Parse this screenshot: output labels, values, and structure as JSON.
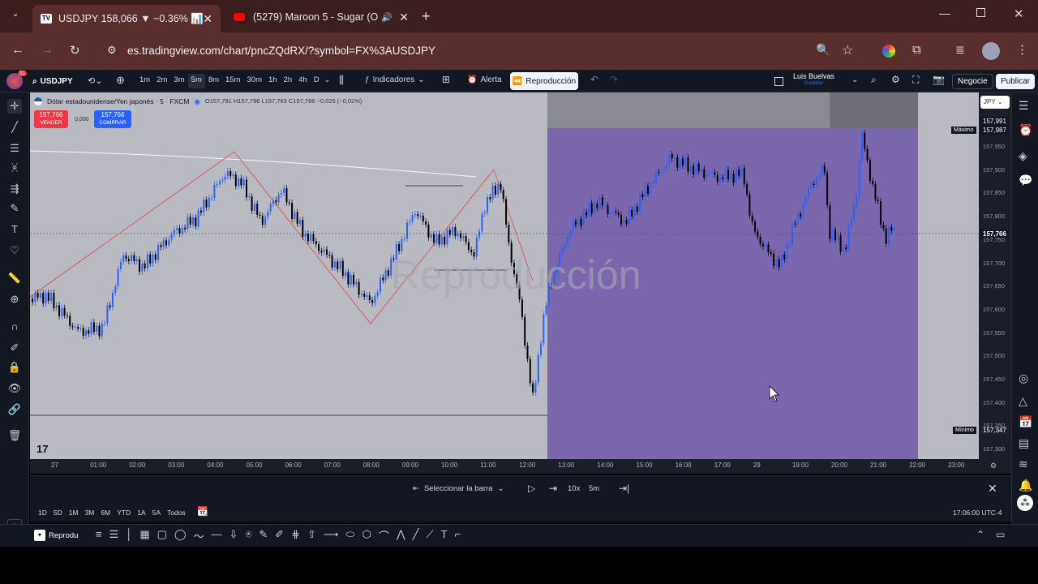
{
  "browser": {
    "tab1_title": "USDJPY 158,066 ▼ −0.36% 📊",
    "tab2_title": "(5279) Maroon 5 - Sugar (O",
    "url": "es.tradingview.com/chart/pncZQdRX/?symbol=FX%3AUSDJPY"
  },
  "toolbar": {
    "symbol": "USDJPY",
    "intervals": [
      "1m",
      "2m",
      "3m",
      "5m",
      "8m",
      "15m",
      "30m",
      "1h",
      "2h",
      "4h",
      "D"
    ],
    "active_interval": "5m",
    "indicators": "Indicadores",
    "alert": "Alerta",
    "replay": "Reproducción",
    "user": "Luis Buelvas",
    "save": "Guardar",
    "trade": "Negocie",
    "publish": "Publicar",
    "badge_count": "11"
  },
  "legend": {
    "title": "Dólar estadounidense/Yen japonés · 5 · FXCM",
    "ohlc": "O157,791 H157,796 L157,763 C157,766 −0,025 (−0,02%)",
    "sell_price": "157,766",
    "sell_label": "VENDER",
    "spread": "0,000",
    "buy_price": "157,766",
    "buy_label": "COMPRAR"
  },
  "watermark": "Reproducción",
  "axis": {
    "currency": "JPY",
    "ticks": [
      "157,950",
      "157,900",
      "157,850",
      "157,800",
      "157,750",
      "157,700",
      "157,650",
      "157,600",
      "157,550",
      "157,500",
      "157,450",
      "157,400",
      "157,350",
      "157,300"
    ],
    "max_label": "Máximo",
    "max_top": "157,991",
    "max_val": "157,987",
    "current": "157,766",
    "min_label": "Mínimo",
    "min_val": "157,347"
  },
  "time_axis": [
    "27",
    "01:00",
    "02:00",
    "03:00",
    "04:00",
    "05:00",
    "06:00",
    "07:00",
    "08:00",
    "09:00",
    "10:00",
    "11:00",
    "12:00",
    "13:00",
    "14:00",
    "15:00",
    "16:00",
    "17:00",
    "29",
    "19:00",
    "20:00",
    "21:00",
    "22:00",
    "23:00"
  ],
  "replay_bar": {
    "select": "Seleccionar la barra",
    "speed": "10x",
    "interval": "5m"
  },
  "ranges": [
    "1D",
    "5D",
    "1M",
    "3M",
    "6M",
    "YTD",
    "1A",
    "5A",
    "Todos"
  ],
  "clock": "17:06:00 UTC-4",
  "drawbar": {
    "label": "Reprodu"
  },
  "colors": {
    "accent": "#2962ff",
    "bull": "#2962ff",
    "bear": "#000000",
    "replay_zone": "#7b67ae",
    "sell": "#f23645"
  }
}
